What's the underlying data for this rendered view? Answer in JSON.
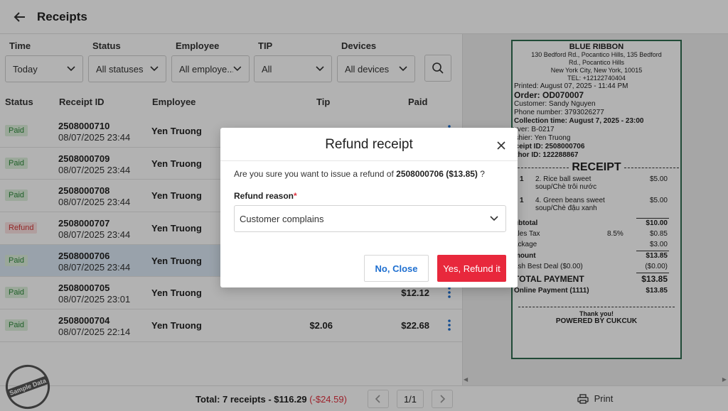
{
  "header": {
    "title": "Receipts"
  },
  "filters": [
    {
      "label": "Time",
      "value": "Today"
    },
    {
      "label": "Status",
      "value": "All statuses"
    },
    {
      "label": "Employee",
      "value": "All employe..."
    },
    {
      "label": "TIP",
      "value": "All"
    },
    {
      "label": "Devices",
      "value": "All devices"
    }
  ],
  "table": {
    "headers": {
      "status": "Status",
      "receipt_id": "Receipt ID",
      "employee": "Employee",
      "tip": "Tip",
      "paid": "Paid"
    },
    "rows": [
      {
        "status": "Paid",
        "id": "2508000710",
        "date": "08/07/2025 23:44",
        "employee": "Yen Truong",
        "tip": "",
        "paid": ""
      },
      {
        "status": "Paid",
        "id": "2508000709",
        "date": "08/07/2025 23:44",
        "employee": "Yen Truong",
        "tip": "",
        "paid": ""
      },
      {
        "status": "Paid",
        "id": "2508000708",
        "date": "08/07/2025 23:44",
        "employee": "Yen Truong",
        "tip": "",
        "paid": ""
      },
      {
        "status": "Refund",
        "id": "2508000707",
        "date": "08/07/2025 23:44",
        "employee": "Yen Truong",
        "tip": "",
        "paid": ""
      },
      {
        "status": "Paid",
        "id": "2508000706",
        "date": "08/07/2025 23:44",
        "employee": "Yen Truong",
        "tip": "",
        "paid": ""
      },
      {
        "status": "Paid",
        "id": "2508000705",
        "date": "08/07/2025 23:01",
        "employee": "Yen Truong",
        "tip": "",
        "paid": "$12.12"
      },
      {
        "status": "Paid",
        "id": "2508000704",
        "date": "08/07/2025 22:14",
        "employee": "Yen Truong",
        "tip": "$2.06",
        "paid": "$22.68"
      }
    ]
  },
  "footer": {
    "total": "Total: 7 receipts - $116.29",
    "refund_total": "(-$24.59)",
    "page": "1/1"
  },
  "sample_stamp": "Sample Data",
  "receipt": {
    "store": "BLUE RIBBON",
    "address1": "130 Bedford Rd., Pocantico Hills, 135 Bedford",
    "address2": "Rd., Pocantico Hills",
    "address3": "New York City, New York, 10015",
    "tel": "TEL: +12122740404",
    "printed": "Printed: August 07, 2025 - 11:44 PM",
    "order": "Order: OD070007",
    "customer": "Customer: Sandy Nguyen",
    "phone": "Phone number: 3793026277",
    "collection": "Collection time: August 7, 2025 - 23:00",
    "server": "erver: B-0217",
    "cashier": "ashier: Yen Truong",
    "receipt_id": "eceipt ID: 2508000706",
    "author_id": "uthor ID: 122288867",
    "title": "RECEIPT",
    "items": [
      {
        "qty": "1",
        "name": "2. Rice ball sweet soup/Chè trôi nước",
        "price": "$5.00"
      },
      {
        "qty": "1",
        "name": "4. Green beans sweet soup/Chè đậu xanh",
        "price": "$5.00"
      }
    ],
    "subtotal_label": "ubtotal",
    "subtotal": "$10.00",
    "tax_label": "ales Tax",
    "tax_rate": "8.5%",
    "tax": "$0.85",
    "package_label": "ackage",
    "package": "$3.00",
    "amount_label": "mount",
    "amount": "$13.85",
    "deal_label": "ash Best Deal ($0.00)",
    "deal": "($0.00)",
    "total_label": "TOTAL PAYMENT",
    "total": "$13.85",
    "online_label": "Online Payment (1111)",
    "online": "$13.85",
    "thanks": "Thank you!",
    "powered": "POWERED BY CUKCUK"
  },
  "print_label": "Print",
  "modal": {
    "title": "Refund receipt",
    "message_prefix": "Are you sure you want to issue a refund of ",
    "message_bold": "2508000706 ($13.85)",
    "message_suffix": " ?",
    "reason_label": "Refund reason",
    "reason_required": "*",
    "reason_value": "Customer complains",
    "no_label": "No, Close",
    "yes_label": "Yes, Refund it"
  }
}
